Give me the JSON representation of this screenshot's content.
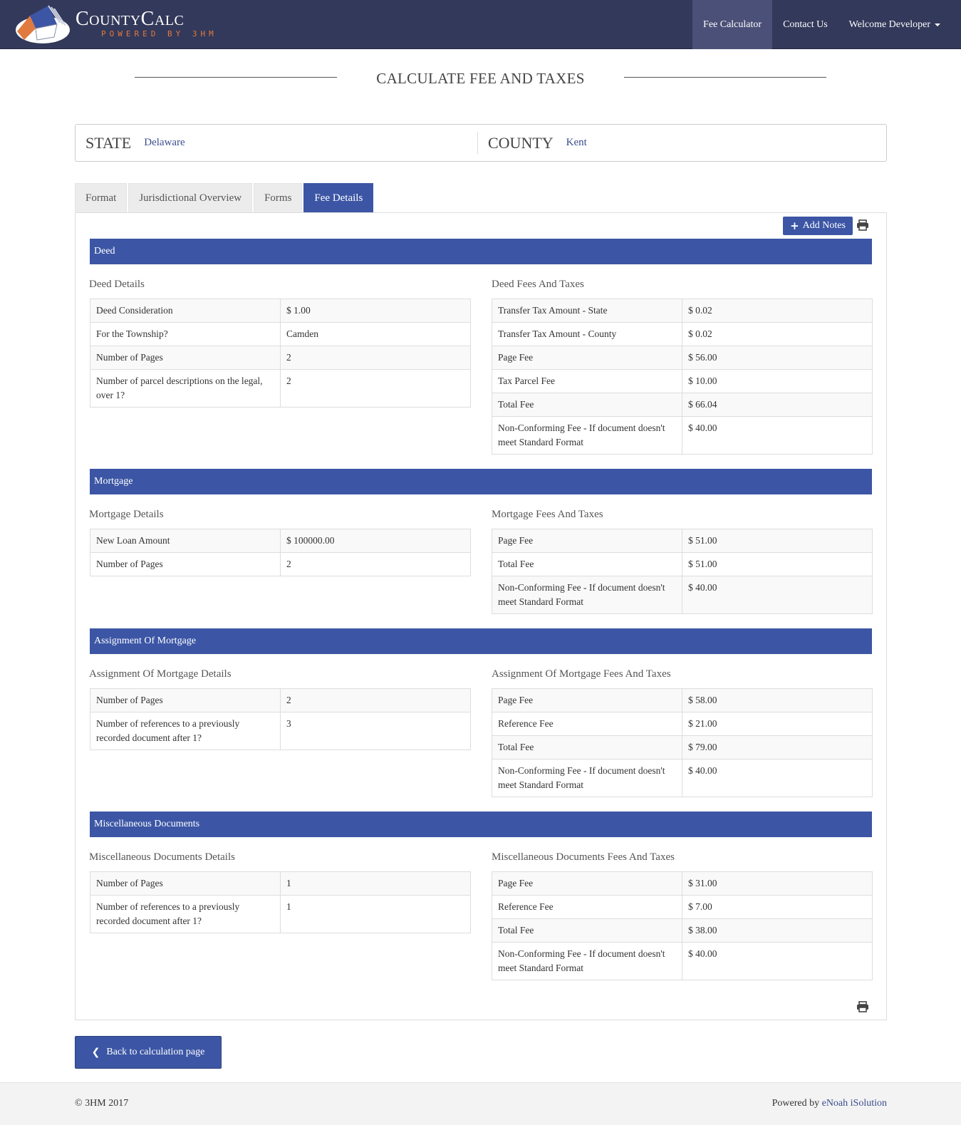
{
  "navbar": {
    "brand_name": "CountyCalc",
    "brand_sub": "POWERED BY 3HM",
    "items": [
      {
        "label": "Fee Calculator"
      },
      {
        "label": "Contact Us"
      },
      {
        "label": "Welcome Developer"
      }
    ]
  },
  "page": {
    "title": "CALCULATE FEE AND TAXES"
  },
  "location": {
    "state_label": "STATE",
    "state_value": "Delaware",
    "county_label": "COUNTY",
    "county_value": "Kent"
  },
  "tabs": [
    {
      "label": "Format"
    },
    {
      "label": "Jurisdictional Overview"
    },
    {
      "label": "Forms"
    },
    {
      "label": "Fee Details"
    }
  ],
  "toolbar": {
    "add_notes_label": "Add Notes",
    "print_icon": "print-icon"
  },
  "sections": [
    {
      "title": "Deed",
      "details_title": "Deed Details",
      "fees_title": "Deed Fees And Taxes",
      "details": [
        {
          "k": "Deed Consideration",
          "v": "$ 1.00"
        },
        {
          "k": "For the Township?",
          "v": "Camden"
        },
        {
          "k": "Number of Pages",
          "v": "2"
        },
        {
          "k": "Number of parcel descriptions on the legal, over 1?",
          "v": "2"
        }
      ],
      "fees": [
        {
          "k": "Transfer Tax Amount - State",
          "v": "$ 0.02"
        },
        {
          "k": "Transfer Tax Amount - County",
          "v": "$ 0.02"
        },
        {
          "k": "Page Fee",
          "v": "$ 56.00"
        },
        {
          "k": "Tax Parcel Fee",
          "v": "$ 10.00"
        },
        {
          "k": "Total Fee",
          "v": "$ 66.04"
        },
        {
          "k": "Non-Conforming Fee - If document doesn't meet Standard Format",
          "v": "$ 40.00"
        }
      ]
    },
    {
      "title": "Mortgage",
      "details_title": "Mortgage Details",
      "fees_title": "Mortgage Fees And Taxes",
      "details": [
        {
          "k": "New Loan Amount",
          "v": "$ 100000.00"
        },
        {
          "k": "Number of Pages",
          "v": "2"
        }
      ],
      "fees": [
        {
          "k": "Page Fee",
          "v": "$ 51.00"
        },
        {
          "k": "Total Fee",
          "v": "$ 51.00"
        },
        {
          "k": "Non-Conforming Fee - If document doesn't meet Standard Format",
          "v": "$ 40.00"
        }
      ]
    },
    {
      "title": "Assignment Of Mortgage",
      "details_title": "Assignment Of Mortgage Details",
      "fees_title": "Assignment Of Mortgage Fees And Taxes",
      "details": [
        {
          "k": "Number of Pages",
          "v": "2"
        },
        {
          "k": "Number of references to a previously recorded document after 1?",
          "v": "3"
        }
      ],
      "fees": [
        {
          "k": "Page Fee",
          "v": "$ 58.00"
        },
        {
          "k": "Reference Fee",
          "v": "$ 21.00"
        },
        {
          "k": "Total Fee",
          "v": "$ 79.00"
        },
        {
          "k": "Non-Conforming Fee - If document doesn't meet Standard Format",
          "v": "$ 40.00"
        }
      ]
    },
    {
      "title": "Miscellaneous Documents",
      "details_title": "Miscellaneous Documents Details",
      "fees_title": "Miscellaneous Documents Fees And Taxes",
      "details": [
        {
          "k": "Number of Pages",
          "v": "1"
        },
        {
          "k": "Number of references to a previously recorded document after 1?",
          "v": "1"
        }
      ],
      "fees": [
        {
          "k": "Page Fee",
          "v": "$ 31.00"
        },
        {
          "k": "Reference Fee",
          "v": "$ 7.00"
        },
        {
          "k": "Total Fee",
          "v": "$ 38.00"
        },
        {
          "k": "Non-Conforming Fee - If document doesn't meet Standard Format",
          "v": "$ 40.00"
        }
      ]
    }
  ],
  "actions": {
    "back_label": "Back to calculation page"
  },
  "footer": {
    "copyright": "© 3HM 2017",
    "powered_prefix": "Powered by",
    "powered_link": "eNoah iSolution"
  },
  "colors": {
    "navbar": "#33395a",
    "accent": "#3c56a5",
    "brand_orange": "#e07a3f"
  }
}
